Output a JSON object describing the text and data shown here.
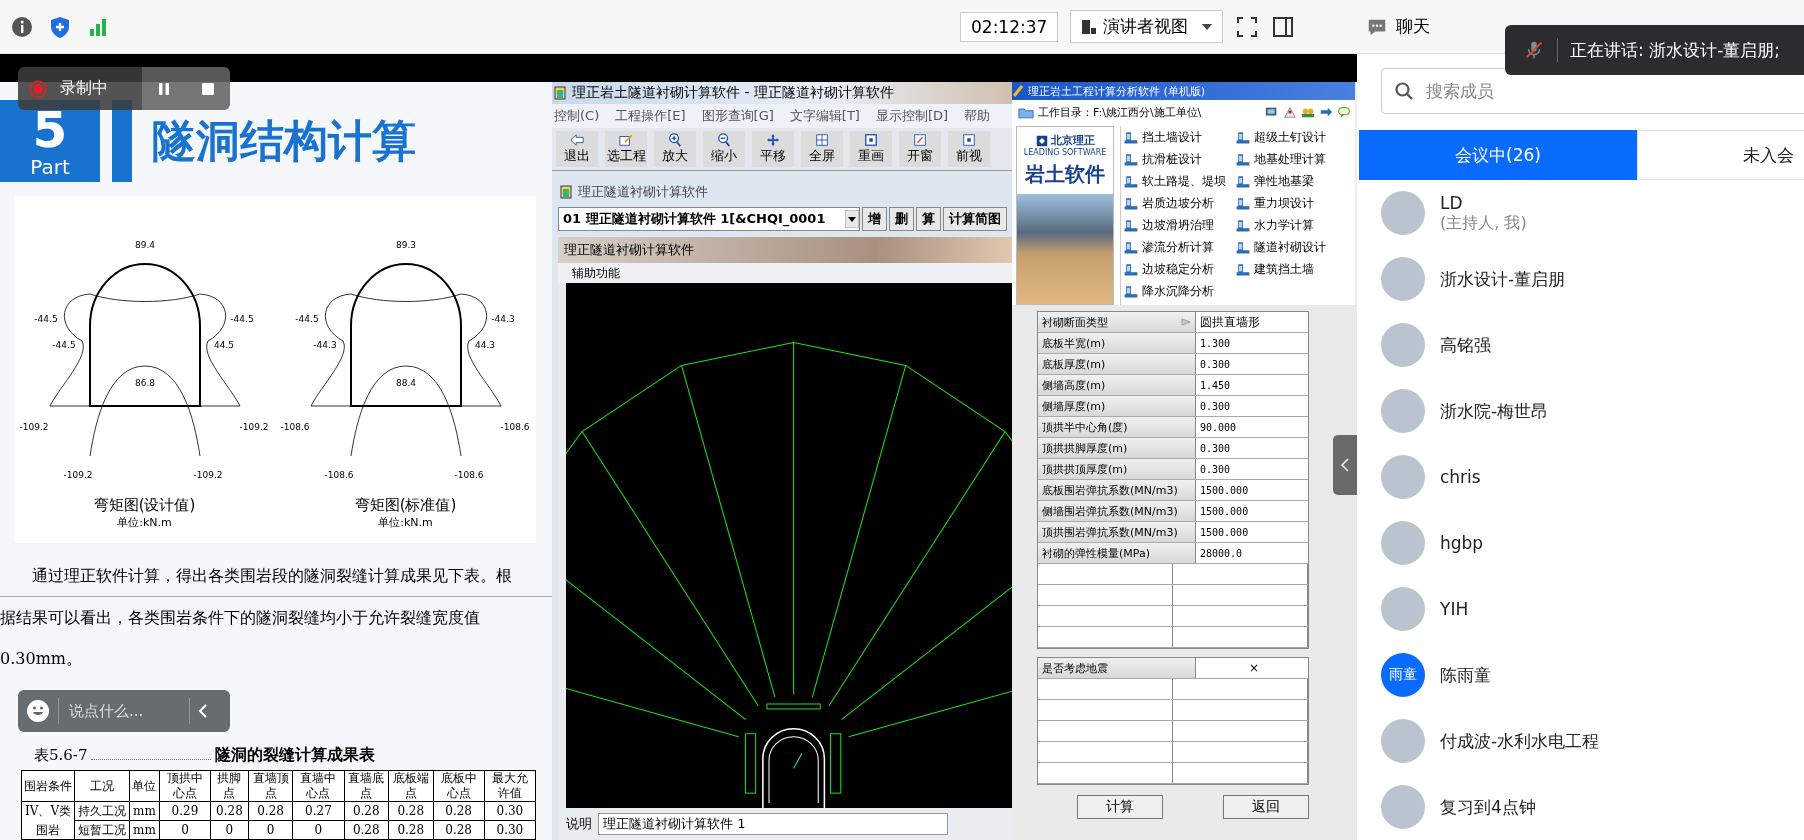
{
  "top_bar": {
    "timer": "02:12:37",
    "view_mode": "演讲者视图",
    "chat_tab": "聊天"
  },
  "speaking_toast": {
    "text": "正在讲话: 浙水设计-董启朋;"
  },
  "recording": {
    "label": "录制中"
  },
  "comment_bar": {
    "placeholder": "说点什么..."
  },
  "slide": {
    "part_number": "5",
    "part_label": "Part",
    "title": "隧洞结构计算",
    "diagrams": [
      {
        "caption": "弯矩图(设计值)",
        "unit": "单位:kN.m",
        "labels": [
          "89.4",
          "-44.5",
          "-44.5",
          "-44.5",
          "44.5",
          "86.8",
          "-109.2",
          "-109.2",
          "-109.2",
          "-109.2"
        ]
      },
      {
        "caption": "弯矩图(标准值)",
        "unit": "单位:kN.m",
        "labels": [
          "89.3",
          "-44.5",
          "-44.3",
          "-44.3",
          "44.3",
          "88.4",
          "-108.6",
          "-108.6",
          "-108.6",
          "-108.6"
        ]
      }
    ],
    "paragraph_lines": [
      "通过理正软件计算，得出各类围岩段的隧洞裂缝计算成果见下表。根",
      "据结果可以看出，各类围岩条件下的隧洞裂缝均小于允许裂缝宽度值",
      "0.30mm。"
    ],
    "table_number": "表5.6-7",
    "table_title": "隧洞的裂缝计算成果表",
    "table": {
      "columns": [
        "围岩条件",
        "工况",
        "单位",
        "顶拱中心点",
        "拱脚点",
        "直墙顶点",
        "直墙中心点",
        "直墙底点",
        "底板端点",
        "底板中心点",
        "最大允许值"
      ],
      "rows": [
        [
          "IV、V类",
          "持久工况",
          "mm",
          "0.29",
          "0.28",
          "0.28",
          "0.27",
          "0.28",
          "0.28",
          "0.28",
          "0.30"
        ],
        [
          "围岩",
          "短暂工况",
          "mm",
          "0",
          "0",
          "0",
          "0",
          "0.28",
          "0.28",
          "0.28",
          "0.30"
        ]
      ]
    }
  },
  "lining_app": {
    "title": "理正岩土隧道衬砌计算软件 - 理正隧道衬砌计算软件",
    "menu": [
      "控制(C)",
      "工程操作[E]",
      "图形查询[G]",
      "文字编辑[T]",
      "显示控制[D]",
      "帮助"
    ],
    "toolbar": [
      {
        "label": "退出",
        "kind": "exit"
      },
      {
        "label": "选工程",
        "kind": "select"
      },
      {
        "label": "放大",
        "kind": "zoom_in"
      },
      {
        "label": "缩小",
        "kind": "zoom_out"
      },
      {
        "label": "平移",
        "kind": "pan"
      },
      {
        "label": "全屏",
        "kind": "full"
      },
      {
        "label": "重画",
        "kind": "redraw"
      },
      {
        "label": "开窗",
        "kind": "window"
      },
      {
        "label": "前视",
        "kind": "front"
      }
    ],
    "subwindow_title": "理正隧道衬砌计算软件",
    "project_select": "01  理正隧道衬砌计算软件 1[&CHQI_0001",
    "actions": [
      "增",
      "删",
      "算",
      "计算简图"
    ],
    "inner_title": "理正隧道衬砌计算软件",
    "panel_label": "辅助功能",
    "note_label": "说明",
    "note_value": "理正隧道衬砌计算软件 1"
  },
  "geo_app": {
    "title": "理正岩土工程计算分析软件 (单机版)",
    "workdir": "工作目录：F:\\姚江西分\\施工单位\\",
    "brand": "北京理正",
    "brand_sub": "LEADING SOFTWARE",
    "banner_title": "岩土软件",
    "modules": [
      "挡土墙设计",
      "超级土钉设计",
      "抗滑桩设计",
      "地基处理计算",
      "软土路堤、堤坝",
      "弹性地基梁",
      "岩质边坡分析",
      "重力坝设计",
      "边坡滑坍治理",
      "水力学计算",
      "渗流分析计算",
      "隧道衬砌设计",
      "边坡稳定分析",
      "建筑挡土墙",
      "降水沉降分析"
    ]
  },
  "params": {
    "rows": [
      {
        "label": "衬砌断面类型",
        "value": "圆拱直墙形",
        "kind": "select"
      },
      {
        "label": "底板半宽(m)",
        "value": "1.300",
        "kind": "number"
      },
      {
        "label": "底板厚度(m)",
        "value": "0.300",
        "kind": "number"
      },
      {
        "label": "侧墙高度(m)",
        "value": "1.450",
        "kind": "number"
      },
      {
        "label": "侧墙厚度(m)",
        "value": "0.300",
        "kind": "number"
      },
      {
        "label": "顶拱半中心角(度)",
        "value": "90.000",
        "kind": "number"
      },
      {
        "label": "顶拱拱脚厚度(m)",
        "value": "0.300",
        "kind": "number"
      },
      {
        "label": "顶拱拱顶厚度(m)",
        "value": "0.300",
        "kind": "number"
      },
      {
        "label": "底板围岩弹抗系数(MN/m3)",
        "value": "1500.000",
        "kind": "number"
      },
      {
        "label": "侧墙围岩弹抗系数(MN/m3)",
        "value": "1500.000",
        "kind": "number"
      },
      {
        "label": "顶拱围岩弹抗系数(MN/m3)",
        "value": "1500.000",
        "kind": "number"
      },
      {
        "label": "衬砌的弹性模量(MPa)",
        "value": "28000.0",
        "kind": "number"
      }
    ],
    "quake": {
      "label": "是否考虑地震",
      "value": "×"
    },
    "buttons": [
      "计算",
      "返回"
    ]
  },
  "sidebar": {
    "search_placeholder": "搜索成员",
    "tabs": [
      {
        "label": "会议中(26)",
        "selected": true
      },
      {
        "label": "未入会",
        "selected": false
      }
    ],
    "members": [
      {
        "name": "LD",
        "role": "(主持人, 我)"
      },
      {
        "name": "浙水设计-董启朋"
      },
      {
        "name": "高铭强"
      },
      {
        "name": "浙水院-梅世昂"
      },
      {
        "name": "chris"
      },
      {
        "name": "hgbp"
      },
      {
        "name": "YIH"
      },
      {
        "name": "陈雨童",
        "avatar_text": "雨童"
      },
      {
        "name": "付成波-水利水电工程"
      },
      {
        "name": "复习到4点钟"
      }
    ]
  }
}
